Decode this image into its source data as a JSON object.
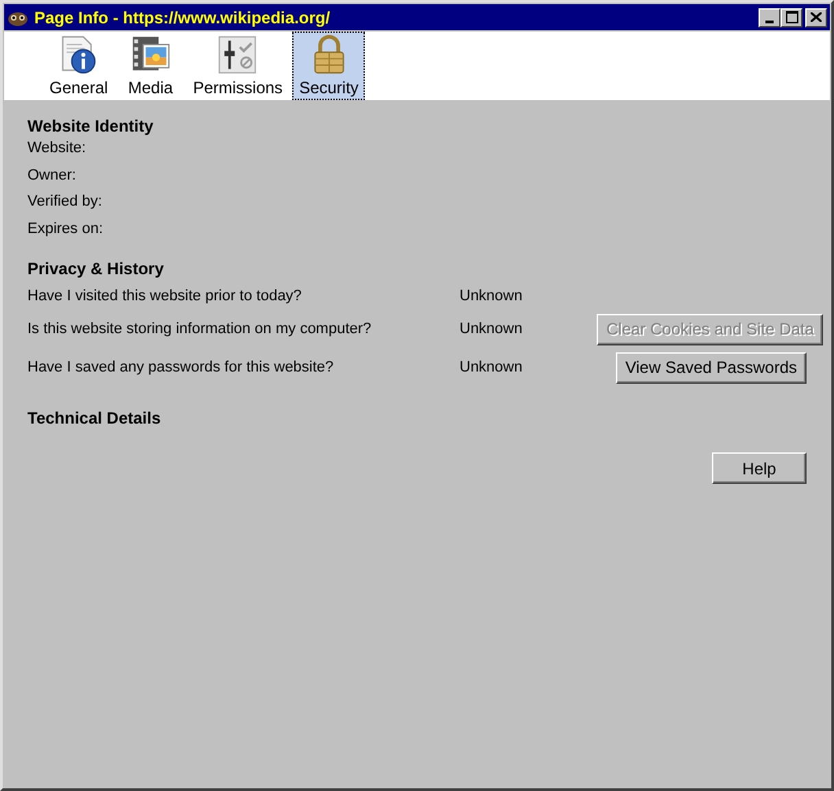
{
  "window": {
    "title": "Page Info - https://www.wikipedia.org/"
  },
  "tabs": [
    {
      "label": "General",
      "selected": false
    },
    {
      "label": "Media",
      "selected": false
    },
    {
      "label": "Permissions",
      "selected": false
    },
    {
      "label": "Security",
      "selected": true
    }
  ],
  "identity": {
    "heading": "Website Identity",
    "fields": [
      "Website:",
      "Owner:",
      "Verified by:",
      "Expires on:"
    ]
  },
  "privacy": {
    "heading": "Privacy & History",
    "rows": [
      {
        "question": "Have I visited this website prior to today?",
        "answer": "Unknown"
      },
      {
        "question": "Is this website storing information on my computer?",
        "answer": "Unknown",
        "button": {
          "label": "Clear Cookies and Site Data",
          "disabled": true
        }
      },
      {
        "question": "Have I saved any passwords for this website?",
        "answer": "Unknown",
        "button": {
          "label": "View Saved Passwords",
          "disabled": false
        }
      }
    ]
  },
  "technical": {
    "heading": "Technical Details"
  },
  "buttons": [
    "Help"
  ]
}
